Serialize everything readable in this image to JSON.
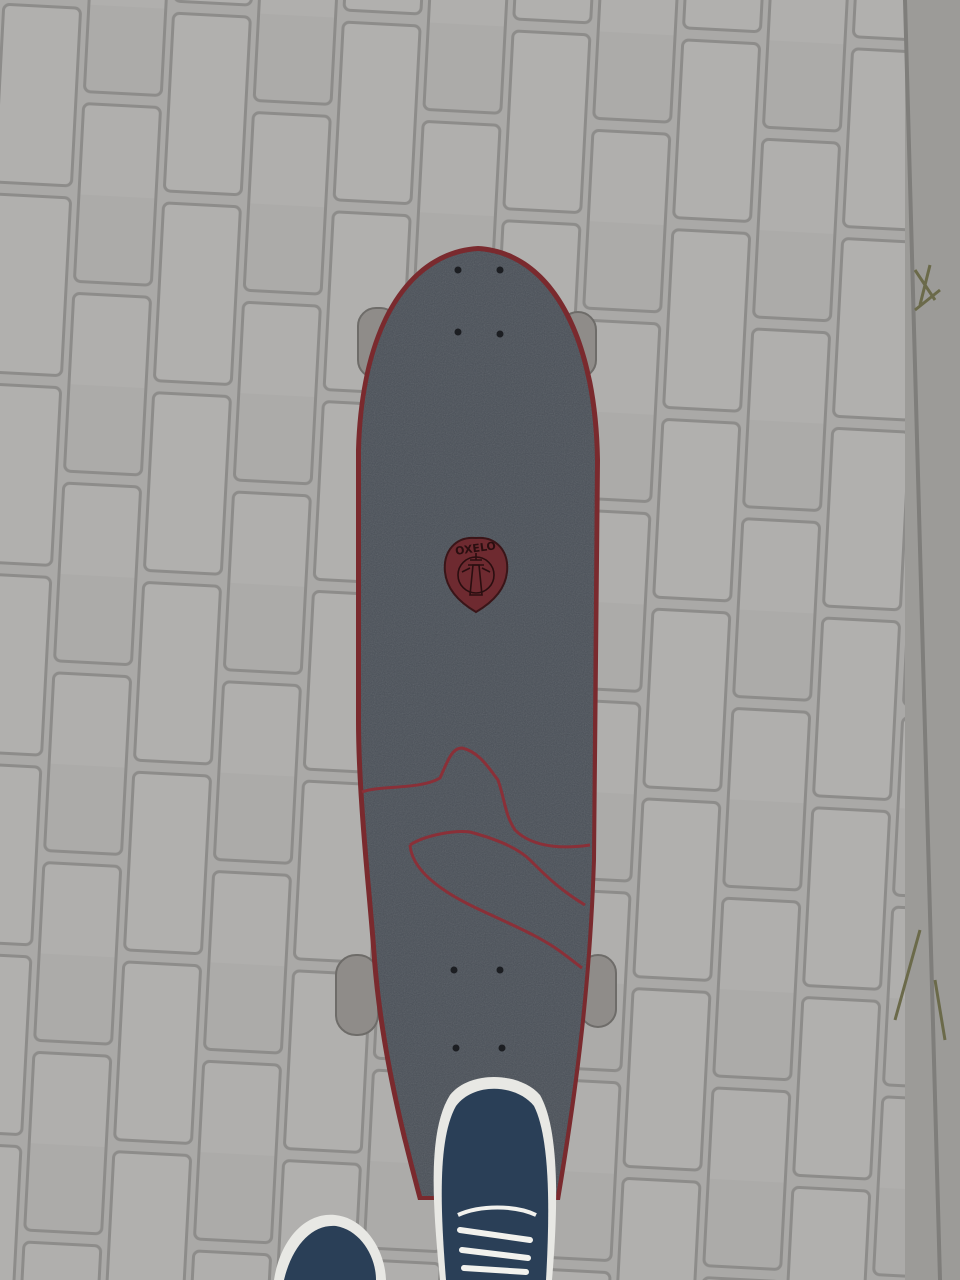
{
  "scene": {
    "description_free": true,
    "colors": {
      "paving": "#a9a8a6",
      "paving_joint": "#8e8d8b",
      "grip_tape": "#4a5058",
      "deck_edge": "#7a2a2e",
      "line_art": "#8a3038",
      "wheel": "#8f8c89",
      "shoe_canvas": "#2a3f57",
      "shoe_sole": "#e8e8e4"
    },
    "logo": {
      "text": "OXELO",
      "icon": "lighthouse-emblem-icon"
    }
  }
}
